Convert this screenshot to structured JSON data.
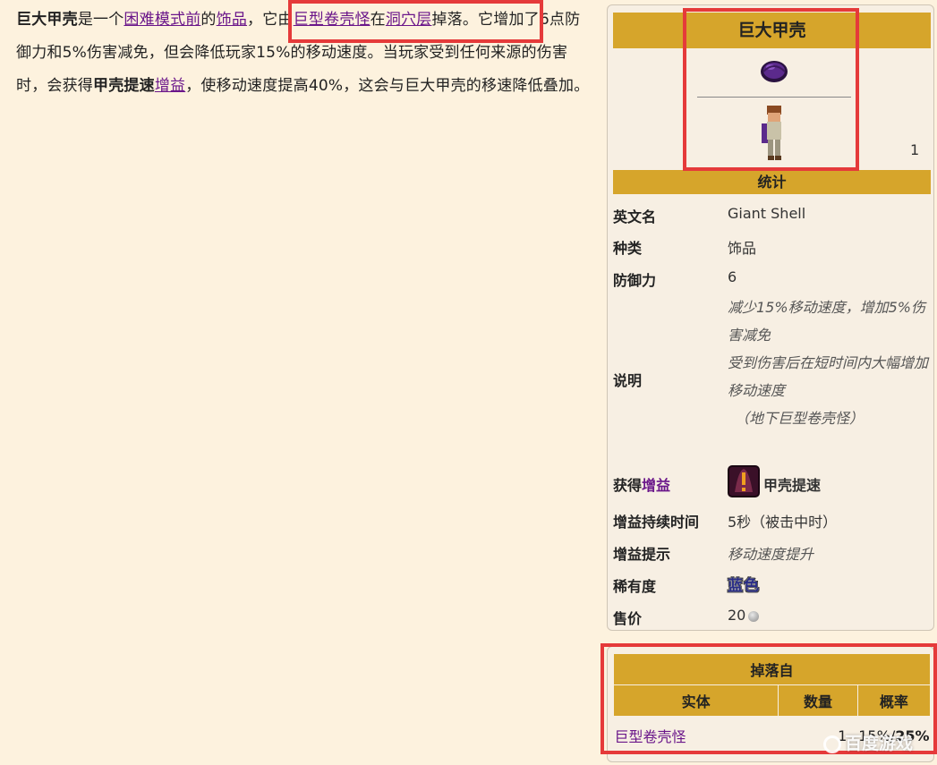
{
  "article": {
    "term": "巨大甲壳",
    "t1": "是一个",
    "link_hardmode": "困难模式前",
    "t2": "的",
    "link_accessory": "饰品",
    "t3": "，它由",
    "link_giant_shelly": "巨型卷壳怪",
    "t4": "在",
    "link_cavern": "洞穴层",
    "t5": "掉落。它增加了6点防御力和5%伤害减免，但会降低玩家15%的移动速度。当玩家受到任何来源的伤害时，会获得",
    "buff_bold": "甲壳提速",
    "link_buff": "增益",
    "t6": "，使移动速度提高40%，这会与巨大甲壳的移速降低叠加。"
  },
  "infobox": {
    "title": "巨大甲壳",
    "count": "1",
    "stats_header": "统计",
    "rows": {
      "english_name_label": "英文名",
      "english_name": "Giant Shell",
      "type_label": "种类",
      "type": "饰品",
      "defense_label": "防御力",
      "defense": "6",
      "description_label": "说明",
      "description_line1": "减少15%移动速度，增加5%伤害减免",
      "description_line2": "受到伤害后在短时间内大幅增加移动速度",
      "description_line3": "（地下巨型卷壳怪）",
      "buff_label_prefix": "获得",
      "buff_label_link": "增益",
      "buff_name": "甲壳提速",
      "buff_duration_label": "增益持续时间",
      "buff_duration": "5秒（被击中时）",
      "buff_tooltip_label": "增益提示",
      "buff_tooltip": "移动速度提升",
      "rarity_label": "稀有度",
      "rarity": "蓝色",
      "sell_label": "售价",
      "sell": "20"
    }
  },
  "drops": {
    "header": "掉落自",
    "col_entity": "实体",
    "col_quantity": "数量",
    "col_rate": "概率",
    "rows": [
      {
        "entity": "巨型卷壳怪",
        "quantity": "1",
        "rate_normal": "15%/",
        "rate_expert": "25%"
      }
    ]
  },
  "watermark": "百度游戏",
  "colors": {
    "header_gold": "#d6a52b",
    "link_purple": "#6a168a",
    "highlight_red": "#e53a3a",
    "page_bg": "#fdf2de"
  }
}
